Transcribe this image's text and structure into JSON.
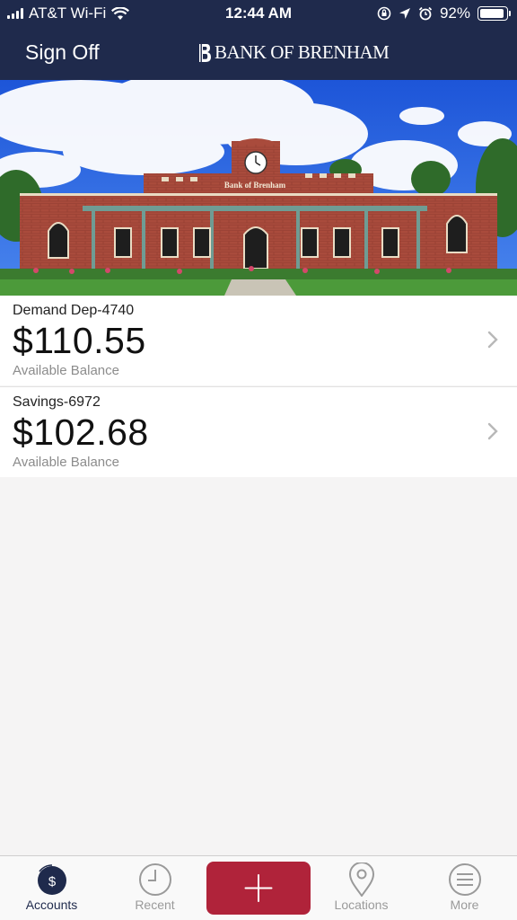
{
  "status_bar": {
    "carrier": "AT&T Wi-Fi",
    "time": "12:44 AM",
    "battery": "92%",
    "battery_level": 0.92
  },
  "header": {
    "sign_off": "Sign Off",
    "logo_text": "BANK OF BRENHAM",
    "building_sign": "Bank of Brenham"
  },
  "accounts": [
    {
      "name": "Demand Dep-4740",
      "balance": "$110.55",
      "caption": "Available Balance"
    },
    {
      "name": "Savings-6972",
      "balance": "$102.68",
      "caption": "Available Balance"
    }
  ],
  "tabs": [
    {
      "label": "Accounts",
      "icon": "dollar-icon",
      "active": true
    },
    {
      "label": "Recent",
      "icon": "clock-icon",
      "active": false
    },
    {
      "label": "",
      "icon": "plus-icon",
      "active": false
    },
    {
      "label": "Locations",
      "icon": "location-pin-icon",
      "active": false
    },
    {
      "label": "More",
      "icon": "menu-icon",
      "active": false
    }
  ],
  "colors": {
    "header_bg": "#1f2a4c",
    "accent_red": "#b0233a",
    "page_bg": "#f5f4f4"
  }
}
